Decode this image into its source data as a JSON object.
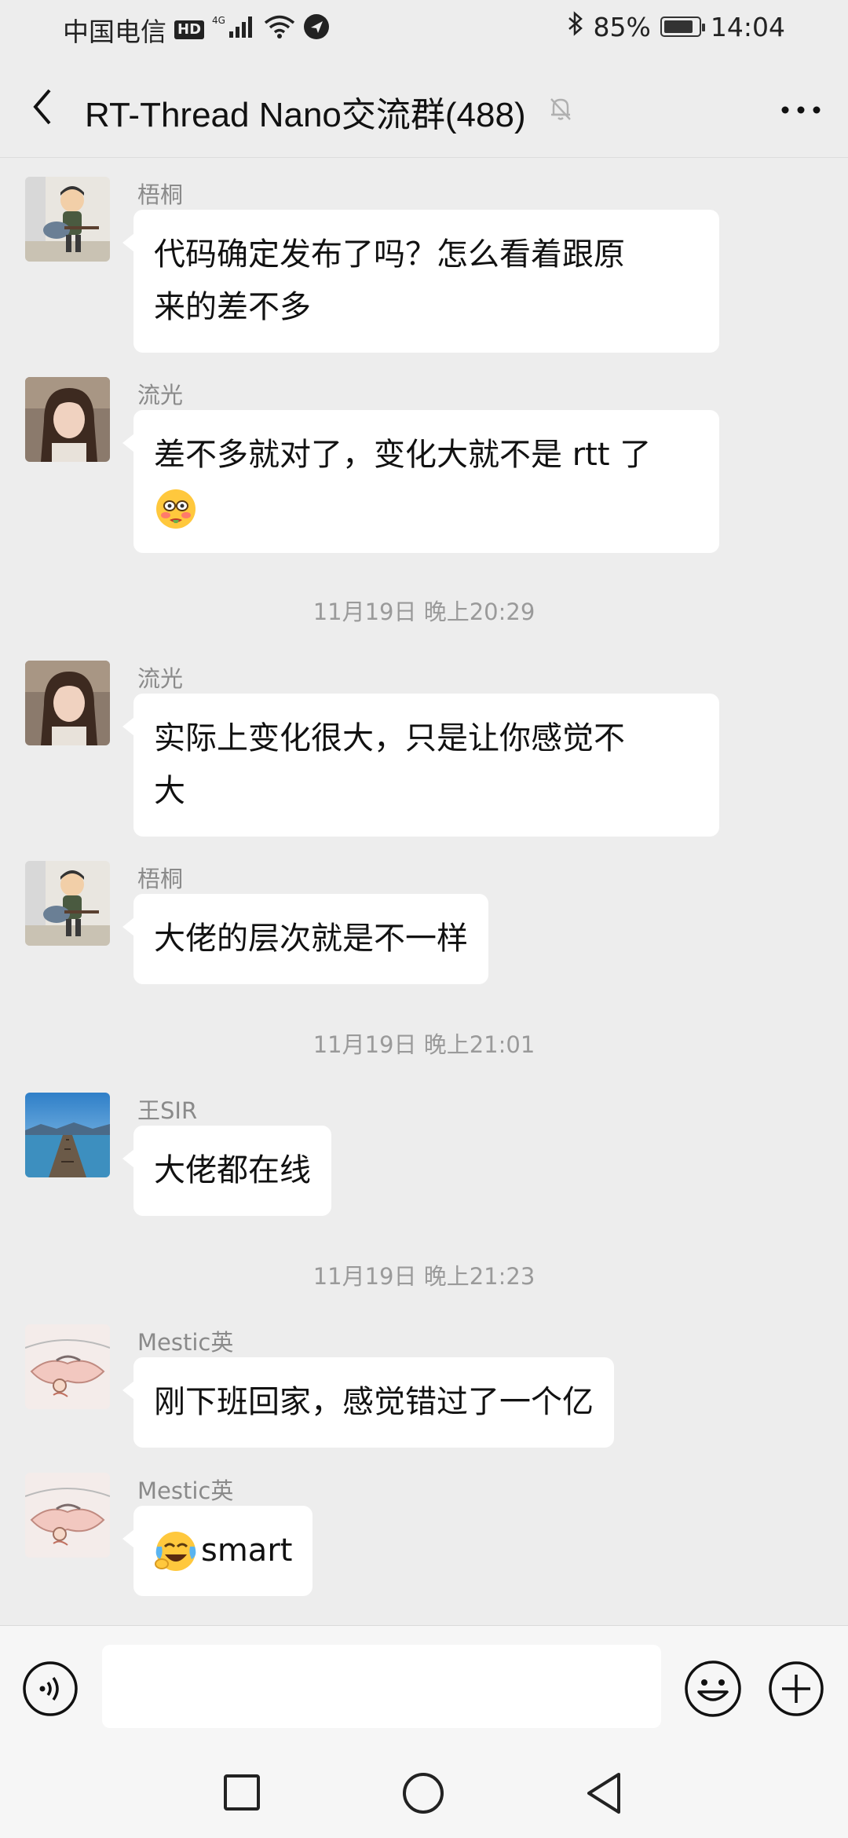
{
  "status_bar": {
    "carrier": "中国电信",
    "hd_badge": "HD",
    "network": "4G",
    "battery_percent": "85%",
    "battery_level": 0.85,
    "time": "14:04"
  },
  "header": {
    "title": "RT-Thread Nano交流群(488)",
    "muted": true
  },
  "messages": [
    {
      "sender": "梧桐",
      "avatar": "guitar-player-avatar",
      "lines": [
        "代码确定发布了吗？怎么看着跟原",
        "来的差不多"
      ]
    },
    {
      "sender": "流光",
      "avatar": "woman-portrait-avatar",
      "lines": [
        "差不多就对了，变化大就不是 rtt 了"
      ],
      "emoji": "blushing-face-emoji"
    },
    {
      "timestamp": "11月19日 晚上20:29"
    },
    {
      "sender": "流光",
      "avatar": "woman-portrait-avatar",
      "lines": [
        "实际上变化很大，只是让你感觉不",
        "大"
      ]
    },
    {
      "sender": "梧桐",
      "avatar": "guitar-player-avatar",
      "lines": [
        "大佬的层次就是不一样"
      ]
    },
    {
      "timestamp": "11月19日 晚上21:01"
    },
    {
      "sender": "王SIR",
      "avatar": "lake-pier-avatar",
      "lines": [
        "大佬都在线"
      ]
    },
    {
      "timestamp": "11月19日 晚上21:23"
    },
    {
      "sender": "Mestic英",
      "avatar": "cartoon-sketch-avatar",
      "lines": [
        "刚下班回家，感觉错过了一个亿"
      ]
    },
    {
      "sender": "Mestic英",
      "avatar": "cartoon-sketch-avatar",
      "emoji_prefix": "laughing-crying-emoji",
      "lines": [
        "smart"
      ]
    }
  ],
  "input_bar": {
    "placeholder": ""
  },
  "colors": {
    "background": "#ededed",
    "bubble": "#ffffff",
    "meta_text": "#8a8a8a"
  }
}
